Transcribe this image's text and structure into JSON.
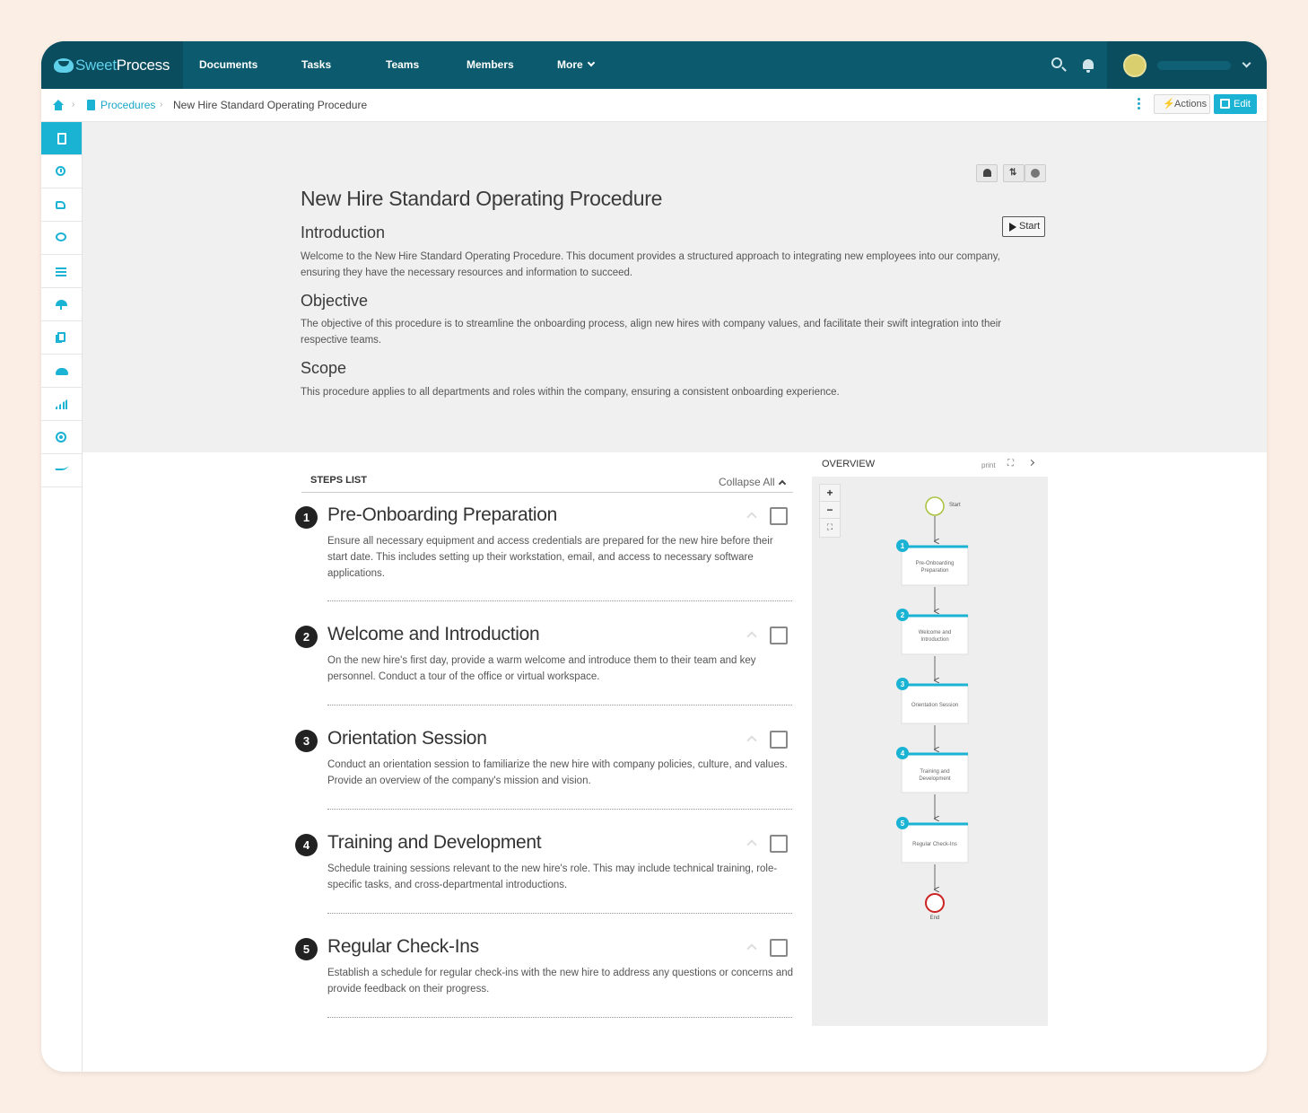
{
  "brand": {
    "sweet": "Sweet",
    "process": "Process"
  },
  "nav": {
    "documents": "Documents",
    "tasks": "Tasks",
    "teams": "Teams",
    "members": "Members",
    "more": "More"
  },
  "icons": {
    "search": "search-icon",
    "notifications": "bell-icon",
    "avatar": "user-avatar",
    "user_menu": "chevron-down-icon"
  },
  "breadcrumb": {
    "sep": "›",
    "procedures": "Procedures",
    "current": "New Hire Standard Operating Procedure"
  },
  "toolbar": {
    "actions": "Actions",
    "edit": "Edit",
    "bolt": "⚡"
  },
  "sidebar": {
    "items": [
      "document-icon",
      "history-icon",
      "approvals-icon",
      "comments-icon",
      "checklist-icon",
      "policy-icon",
      "copies-icon",
      "users-icon",
      "stats-icon",
      "settings-icon",
      "signature-icon"
    ]
  },
  "document": {
    "title": "New Hire Standard Operating Procedure",
    "start": "Start",
    "sort_glyph": "⇅",
    "sections": [
      {
        "heading": "Introduction",
        "text": "Welcome to the New Hire Standard Operating Procedure. This document provides a structured approach to integrating new employees into our company, ensuring they have the necessary resources and information to succeed."
      },
      {
        "heading": "Objective",
        "text": "The objective of this procedure is to streamline the onboarding process, align new hires with company values, and facilitate their swift integration into their respective teams."
      },
      {
        "heading": "Scope",
        "text": "This procedure applies to all departments and roles within the company, ensuring a consistent onboarding experience."
      }
    ]
  },
  "steps_list": {
    "heading": "STEPS LIST",
    "collapse_all": "Collapse All",
    "steps": [
      {
        "num": "1",
        "title": "Pre-Onboarding Preparation",
        "text": "Ensure all necessary equipment and access credentials are prepared for the new hire before their start date. This includes setting up their workstation, email, and access to necessary software applications."
      },
      {
        "num": "2",
        "title": "Welcome and Introduction",
        "text": "On the new hire's first day, provide a warm welcome and introduce them to their team and key personnel. Conduct a tour of the office or virtual workspace."
      },
      {
        "num": "3",
        "title": "Orientation Session",
        "text": "Conduct an orientation session to familiarize the new hire with company policies, culture, and values. Provide an overview of the company's mission and vision."
      },
      {
        "num": "4",
        "title": "Training and Development",
        "text": "Schedule training sessions relevant to the new hire's role. This may include technical training, role-specific tasks, and cross-departmental introductions."
      },
      {
        "num": "5",
        "title": "Regular Check-Ins",
        "text": "Establish a schedule for regular check-ins with the new hire to address any questions or concerns and provide feedback on their progress."
      }
    ]
  },
  "overview": {
    "heading": "OVERVIEW",
    "print": "print",
    "expand_glyph": "⛶",
    "zoom_in": "+",
    "zoom_out": "−",
    "fit": "⛶",
    "start_label": "Start",
    "end_label": "End",
    "nodes": [
      {
        "num": "1",
        "line1": "Pre-Onboarding",
        "line2": "Preparation"
      },
      {
        "num": "2",
        "line1": "Welcome and",
        "line2": "Introduction"
      },
      {
        "num": "3",
        "line1": "Orientation Session",
        "line2": ""
      },
      {
        "num": "4",
        "line1": "Training and",
        "line2": "Development"
      },
      {
        "num": "5",
        "line1": "Regular Check-Ins",
        "line2": ""
      }
    ]
  },
  "colors": {
    "nav_bg": "#0b5a6e",
    "accent": "#1bb3d4",
    "end_node": "#cc2222",
    "start_node": "#a8c23a"
  }
}
